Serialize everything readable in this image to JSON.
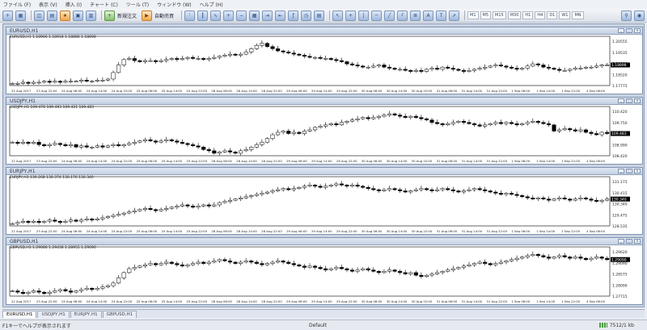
{
  "menu": [
    "ファイル (F)",
    "表示 (V)",
    "挿入 (I)",
    "チャート (C)",
    "ツール (T)",
    "ウィンドウ (W)",
    "ヘルプ (H)"
  ],
  "toolbar": {
    "new_order": "新規注文",
    "auto_trading": "自動売買",
    "timeframes": [
      "M1",
      "M5",
      "M15",
      "M30",
      "H1",
      "H4",
      "D1",
      "W1",
      "MN"
    ]
  },
  "x_labels": [
    "22 Aug 2017",
    "23 Aug 22:00",
    "24 Aug 06:00",
    "24 Aug 14:00",
    "24 Aug 22:00",
    "25 Aug 06:00",
    "25 Aug 14:00",
    "25 Aug 22:00",
    "28 Aug 06:00",
    "28 Aug 14:00",
    "28 Aug 22:00",
    "29 Aug 06:00",
    "29 Aug 14:00",
    "29 Aug 22:00",
    "30 Aug 06:00",
    "30 Aug 14:00",
    "30 Aug 22:00",
    "31 Aug 06:00",
    "31 Aug 14:00",
    "31 Aug 22:00",
    "1 Sep 06:00",
    "1 Sep 14:00",
    "1 Sep 22:00",
    "4 Sep 06:00"
  ],
  "charts": [
    {
      "title": "EURUSD,H1",
      "ohlc": "EURUSD,H1  1.18906 1.18918 1.18880 1.18898",
      "y_labels": [
        "1.20555",
        "1.19535",
        "1.18898",
        "1.18520",
        "1.17775"
      ],
      "current_price": "1.18898",
      "series": [
        10,
        10,
        11,
        10,
        11,
        11,
        12,
        11,
        12,
        11,
        12,
        12,
        12,
        13,
        12,
        12,
        13,
        13,
        14,
        20,
        27,
        32,
        33,
        31,
        30,
        31,
        31,
        30,
        31,
        32,
        33,
        32,
        33,
        34,
        33,
        33,
        32,
        33,
        34,
        35,
        36,
        37,
        36,
        37,
        39,
        42,
        45,
        47,
        44,
        42,
        40,
        39,
        38,
        37,
        36,
        35,
        34,
        34,
        33,
        33,
        32,
        31,
        30,
        28,
        27,
        26,
        25,
        25,
        26,
        27,
        25,
        24,
        23,
        23,
        22,
        21,
        22,
        21,
        23,
        24,
        23,
        25,
        24,
        23,
        22,
        21,
        22,
        23,
        24,
        25,
        26,
        27,
        26,
        25,
        24,
        23,
        24,
        26,
        28,
        27,
        25,
        24,
        23,
        22,
        22,
        23,
        24,
        24,
        25,
        25,
        26,
        27,
        27
      ]
    },
    {
      "title": "USDJPY,H1",
      "ohlc": "USDJPY,H1  109.478 109.493 109.421 109.483",
      "y_labels": [
        "110.420",
        "109.750",
        "109.483",
        "108.990",
        "108.420"
      ],
      "current_price": "109.483",
      "series": [
        20,
        19,
        20,
        19,
        20,
        18,
        17,
        18,
        19,
        18,
        17,
        18,
        16,
        17,
        16,
        16,
        17,
        16,
        17,
        18,
        17,
        18,
        19,
        20,
        21,
        22,
        21,
        20,
        21,
        22,
        21,
        20,
        19,
        18,
        17,
        16,
        14,
        13,
        11,
        12,
        13,
        12,
        11,
        13,
        14,
        16,
        18,
        20,
        23,
        26,
        28,
        29,
        27,
        28,
        27,
        29,
        30,
        32,
        33,
        34,
        35,
        34,
        36,
        37,
        38,
        39,
        40,
        39,
        40,
        41,
        42,
        43,
        42,
        41,
        40,
        41,
        40,
        39,
        38,
        36,
        35,
        34,
        35,
        36,
        37,
        36,
        35,
        34,
        33,
        34,
        35,
        36,
        35,
        36,
        35,
        34,
        35,
        36,
        37,
        36,
        35,
        34,
        29,
        30,
        31,
        30,
        29,
        30,
        28,
        27,
        26,
        28,
        27
      ]
    },
    {
      "title": "EURJPY,H1",
      "ohlc": "EURJPY,H1  130.268 130.374 130.176 130.340",
      "y_labels": [
        "131.175",
        "130.415",
        "130.340",
        "129.475",
        "128.535"
      ],
      "current_price": "130.340",
      "series": [
        8,
        9,
        10,
        9,
        10,
        9,
        10,
        11,
        10,
        9,
        10,
        11,
        10,
        11,
        12,
        11,
        12,
        13,
        14,
        15,
        16,
        17,
        18,
        19,
        20,
        21,
        20,
        19,
        20,
        21,
        22,
        23,
        24,
        23,
        22,
        23,
        24,
        23,
        24,
        26,
        27,
        28,
        29,
        30,
        31,
        32,
        33,
        34,
        35,
        36,
        37,
        38,
        37,
        38,
        39,
        40,
        41,
        40,
        39,
        40,
        41,
        42,
        41,
        40,
        41,
        40,
        39,
        38,
        37,
        36,
        37,
        38,
        37,
        36,
        35,
        36,
        37,
        38,
        37,
        36,
        37,
        38,
        37,
        36,
        35,
        36,
        37,
        38,
        37,
        36,
        35,
        34,
        33,
        34,
        33,
        32,
        31,
        30,
        29,
        30,
        29,
        28,
        29,
        30,
        29,
        28,
        29,
        30,
        29,
        28,
        27,
        28,
        29
      ]
    },
    {
      "title": "GBPUSD,H1",
      "ohlc": "GBPUSD,H1  1.29080 1.29438 1.28955 1.29090",
      "y_labels": [
        "1.29620",
        "1.29090",
        "1.28575",
        "1.28090",
        "1.27715"
      ],
      "current_price": "1.29090",
      "series": [
        10,
        9,
        8,
        9,
        10,
        9,
        8,
        9,
        10,
        11,
        10,
        9,
        10,
        11,
        12,
        11,
        12,
        13,
        14,
        16,
        20,
        24,
        27,
        28,
        29,
        30,
        31,
        30,
        31,
        32,
        31,
        30,
        29,
        30,
        31,
        32,
        31,
        32,
        33,
        34,
        33,
        32,
        31,
        32,
        33,
        32,
        31,
        30,
        31,
        32,
        33,
        32,
        31,
        30,
        29,
        28,
        29,
        28,
        27,
        26,
        27,
        28,
        27,
        26,
        25,
        26,
        27,
        26,
        25,
        24,
        25,
        26,
        25,
        24,
        23,
        24,
        22,
        21,
        22,
        23,
        24,
        25,
        26,
        27,
        28,
        29,
        30,
        31,
        32,
        31,
        30,
        31,
        32,
        33,
        34,
        35,
        36,
        37,
        38,
        37,
        36,
        35,
        36,
        37,
        36,
        35,
        36,
        35,
        34,
        35,
        36,
        35,
        34
      ]
    }
  ],
  "tabs": [
    "EURUSD,H1",
    "USDJPY,H1",
    "EURJPY,H1",
    "GBPUSD,H1"
  ],
  "status": {
    "help": "F1キーでヘルプが表示されます",
    "profile": "Default",
    "connection": "7512/1 kb"
  }
}
